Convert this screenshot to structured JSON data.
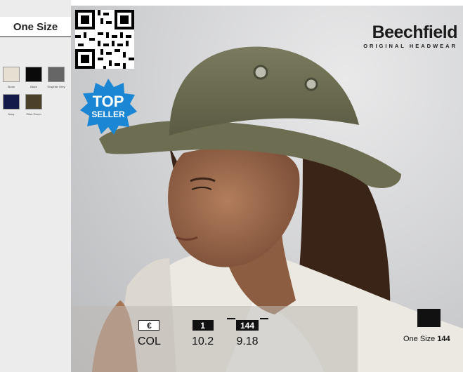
{
  "sidebar": {
    "size_label": "One Size",
    "swatches": [
      {
        "name": "Stone",
        "color": "#e6e0d2"
      },
      {
        "name": "Black",
        "color": "#0a0a0a"
      },
      {
        "name": "Graphite Grey",
        "color": "#666666"
      },
      {
        "name": "Navy",
        "color": "#141a4a"
      },
      {
        "name": "Olive Green",
        "color": "#4a4128"
      }
    ]
  },
  "brand": {
    "name": "Beechfield",
    "sub": "ORIGINAL HEADWEAR"
  },
  "badge": {
    "line1": "TOP",
    "line2": "SELLER",
    "color": "#1b86d4"
  },
  "pricing": {
    "currency_icon": "€",
    "currency_label": "COL",
    "qty1_label": "1",
    "qty1_value": "10.2",
    "qty2_label": "144",
    "qty2_value": "9.18"
  },
  "box": {
    "icon": "carton-box-icon",
    "label": "One Size",
    "qty": "144"
  }
}
